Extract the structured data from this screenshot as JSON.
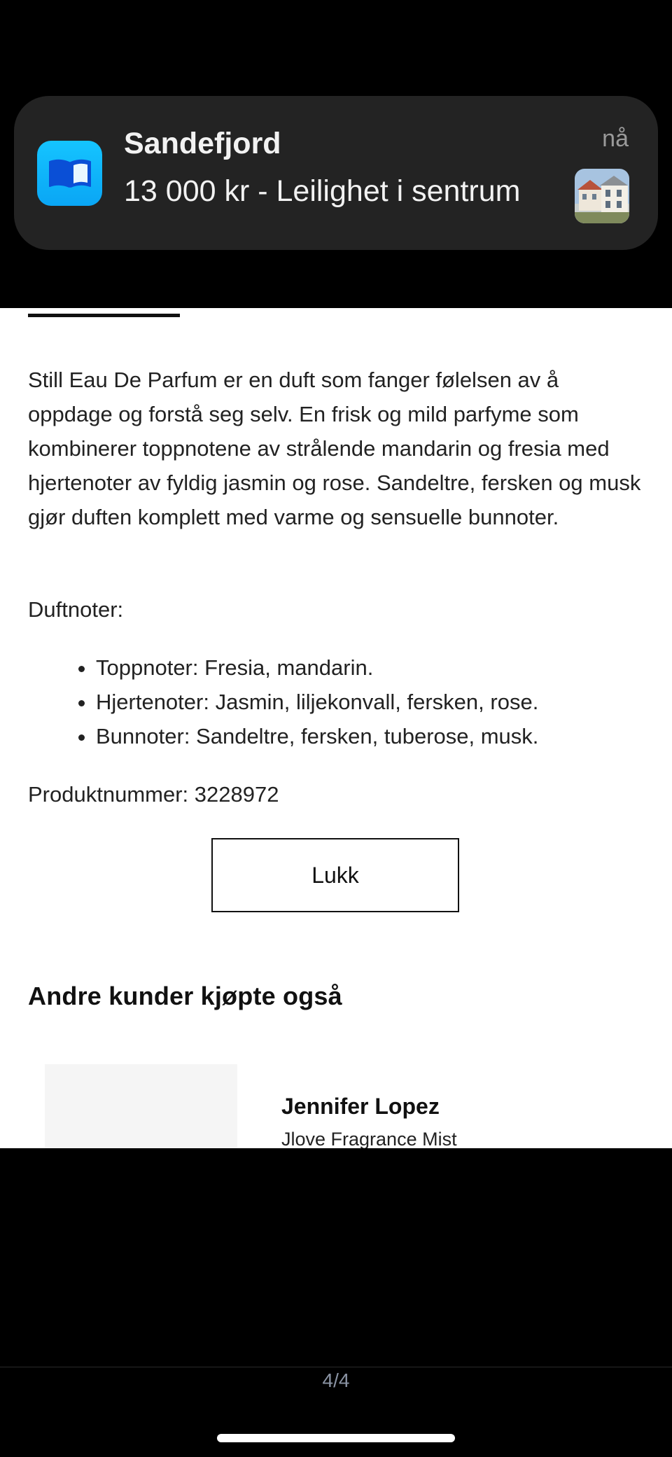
{
  "notification": {
    "title": "Sandefjord",
    "body": "13 000 kr - Leilighet i sentrum",
    "time": "nå",
    "app_icon": "book-icon",
    "thumbnail": "house-photo"
  },
  "product": {
    "description": "Still Eau De Parfum er en duft som fanger følelsen av å oppdage og forstå seg selv. En frisk og mild parfyme som kombinerer toppnotene av strålende mandarin og fresia med hjertenoter av fyldig jasmin og rose. Sandeltre, fersken og musk gjør duften komplett med varme og sensuelle bunnoter.",
    "notes_title": "Duftnoter:",
    "notes": [
      "Toppnoter: Fresia, mandarin.",
      "Hjertenoter: Jasmin, liljekonvall, fersken, rose.",
      "Bunnoter: Sandeltre, fersken, tuberose, musk."
    ],
    "product_number": "Produktnummer: 3228972",
    "close_label": "Lukk"
  },
  "recommendations": {
    "heading": "Andre kunder kjøpte også",
    "items": [
      {
        "brand": "Jennifer Lopez",
        "name": "Jlove Fragrance Mist"
      }
    ]
  },
  "viewer": {
    "page_indicator": "4/4"
  }
}
